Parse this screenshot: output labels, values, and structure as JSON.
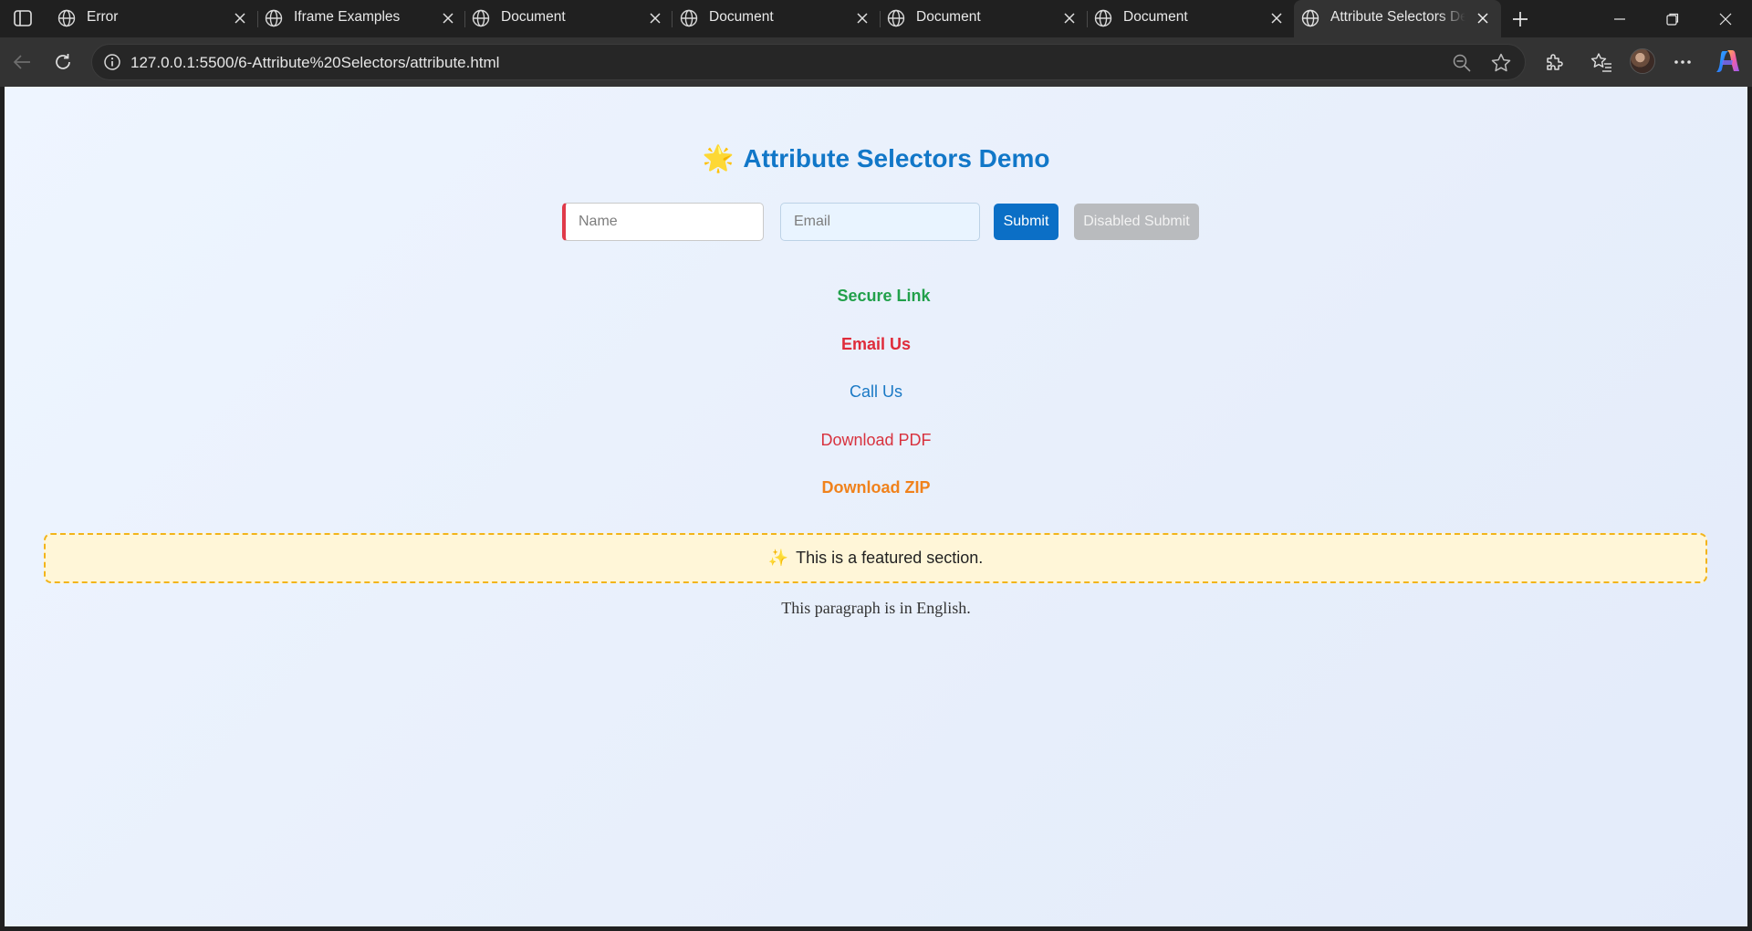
{
  "browser": {
    "tabs": [
      {
        "title": "Error",
        "active": false
      },
      {
        "title": "Iframe Examples",
        "active": false
      },
      {
        "title": "Document",
        "active": false
      },
      {
        "title": "Document",
        "active": false
      },
      {
        "title": "Document",
        "active": false
      },
      {
        "title": "Document",
        "active": false
      },
      {
        "title": "Attribute Selectors Demo",
        "active": true
      }
    ],
    "url": "127.0.0.1:5500/6-Attribute%20Selectors/attribute.html"
  },
  "page": {
    "title_icon": "🌟",
    "title": "Attribute Selectors Demo",
    "form": {
      "name_placeholder": "Name",
      "email_placeholder": "Email",
      "submit_label": "Submit",
      "disabled_submit_label": "Disabled Submit"
    },
    "links": {
      "secure": "Secure Link",
      "email": "Email Us",
      "call": "Call Us",
      "pdf": "Download PDF",
      "zip": "Download ZIP"
    },
    "featured_icon": "✨",
    "featured_text": "This is a featured section.",
    "english_text": "This paragraph is in English."
  },
  "colors": {
    "title": "#1177c8",
    "secure_link": "#22a04b",
    "email_link": "#df2b3a",
    "call_link": "#1a79c5",
    "pdf_link": "#d8323e",
    "zip_link": "#f0821c",
    "featured_border": "#f2b41a",
    "submit_button": "#0b6fc6"
  }
}
